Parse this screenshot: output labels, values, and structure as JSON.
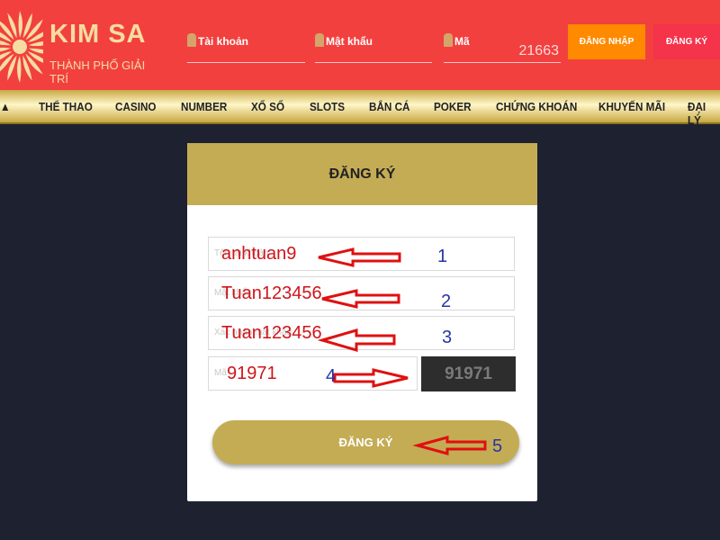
{
  "header": {
    "logo_title": "KIM SA",
    "logo_subtitle": "THÀNH PHỐ GIẢI TRÍ",
    "account_label": "Tài khoản",
    "password_label": "Mật khẩu",
    "code_label": "Mã",
    "code_value": "21663",
    "login_button": "ĐĂNG NHẬP",
    "register_button": "ĐĂNG KÝ"
  },
  "nav": {
    "items": [
      "THỂ THAO",
      "CASINO",
      "NUMBER",
      "XỔ SỐ",
      "SLOTS",
      "BẮN CÁ",
      "POKER",
      "CHỨNG KHOÁN",
      "KHUYẾN MÃI",
      "ĐẠI LÝ"
    ]
  },
  "form": {
    "title": "ĐĂNG KÝ",
    "fields": [
      {
        "placeholder": "Tên tài khoản",
        "value": "anhtuan9"
      },
      {
        "placeholder": "Mật khẩu",
        "value": "Tuan123456"
      },
      {
        "placeholder": "Xác nhận mật khẩu",
        "value": "Tuan123456"
      },
      {
        "placeholder": "Mã",
        "value": "91971"
      }
    ],
    "captcha": "91971",
    "submit": "ĐĂNG KÝ"
  },
  "annotations": [
    "1",
    "2",
    "3",
    "4",
    "5"
  ],
  "colors": {
    "header": "#f2403f",
    "gold": "#c4ac55",
    "login": "#ff8a00",
    "register": "#f5334a",
    "annotation_arrow": "#e01010",
    "annotation_number": "#2734a8"
  }
}
